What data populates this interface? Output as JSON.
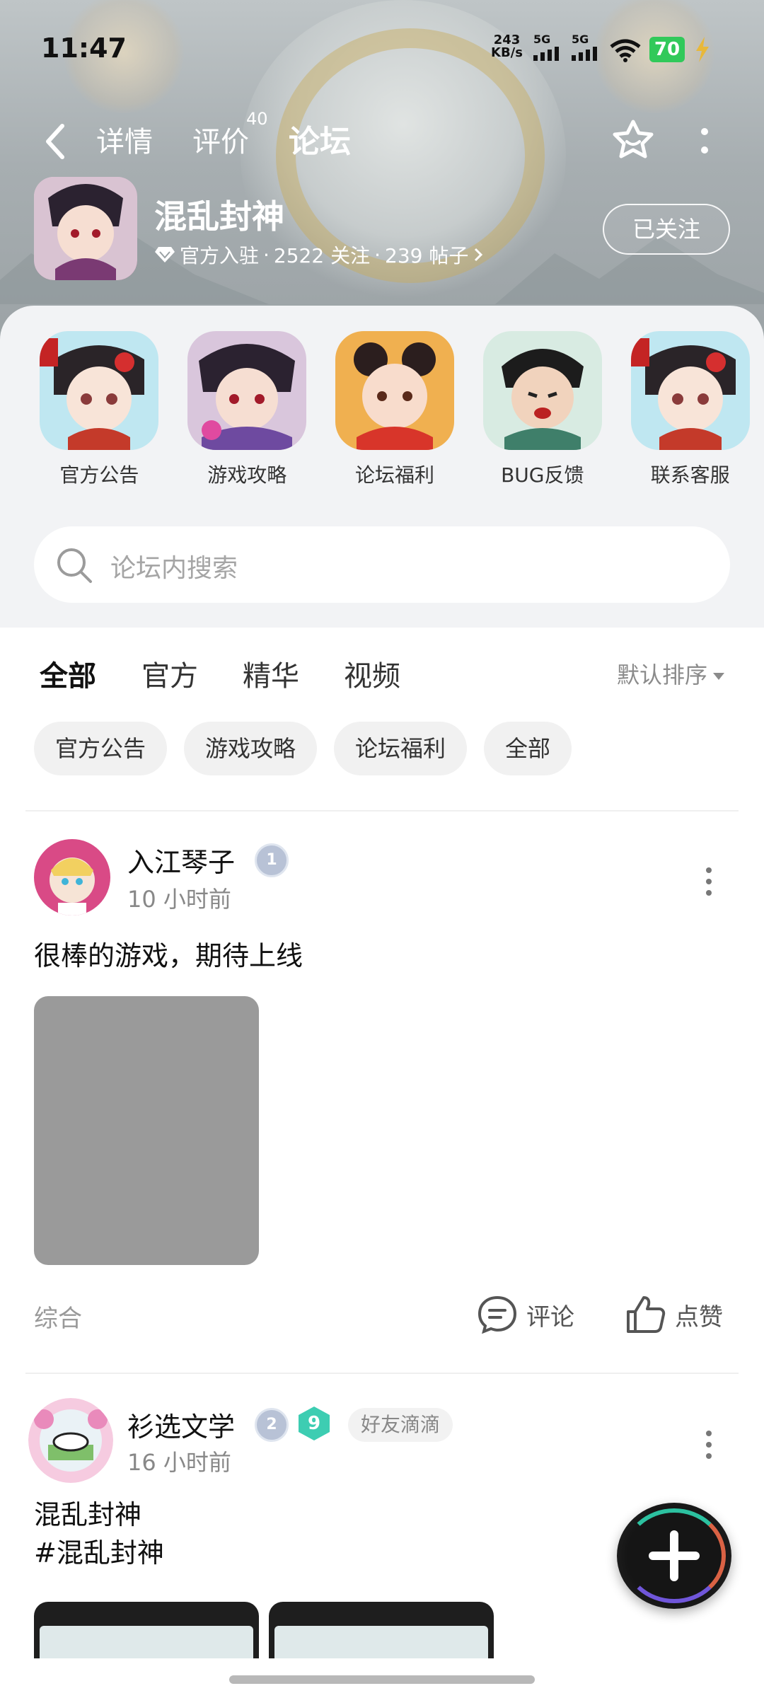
{
  "status_bar": {
    "time": "11:47",
    "net_speed_value": "243",
    "net_speed_unit": "KB/s",
    "sim1": "5G",
    "sim2": "5G",
    "battery": "70"
  },
  "nav": {
    "tabs": [
      {
        "label": "详情"
      },
      {
        "label": "评价",
        "count": "40"
      },
      {
        "label": "论坛",
        "active": true
      }
    ],
    "icons": [
      "back-arrow-icon",
      "star-badge-icon",
      "more-vertical-icon"
    ]
  },
  "game": {
    "title": "混乱封神",
    "verified": "官方入驻",
    "followers": "2522 关注",
    "posts": "239 帖子",
    "follow_button": "已关注"
  },
  "shortcuts": [
    {
      "label": "官方公告"
    },
    {
      "label": "游戏攻略"
    },
    {
      "label": "论坛福利"
    },
    {
      "label": "BUG反馈"
    },
    {
      "label": "联系客服"
    }
  ],
  "search": {
    "placeholder": "论坛内搜索"
  },
  "filter_tabs": [
    {
      "label": "全部",
      "active": true
    },
    {
      "label": "官方"
    },
    {
      "label": "精华"
    },
    {
      "label": "视频"
    }
  ],
  "sort": {
    "label": "默认排序"
  },
  "chips": [
    "官方公告",
    "游戏攻略",
    "论坛福利",
    "全部"
  ],
  "posts": [
    {
      "user": "入江琴子",
      "level": "1",
      "time": "10 小时前",
      "text": "很棒的游戏，期待上线",
      "category": "综合",
      "comment_label": "评论",
      "like_label": "点赞"
    },
    {
      "user": "衫选文学",
      "level": "2",
      "vip": "9",
      "tag": "好友滴滴",
      "time": "16 小时前",
      "title": "混乱封神",
      "hashtag": "#混乱封神"
    }
  ],
  "colors": {
    "accent": "#2fd4b0",
    "battery": "#31c95a",
    "text_primary": "#111111",
    "text_secondary": "#888888"
  }
}
